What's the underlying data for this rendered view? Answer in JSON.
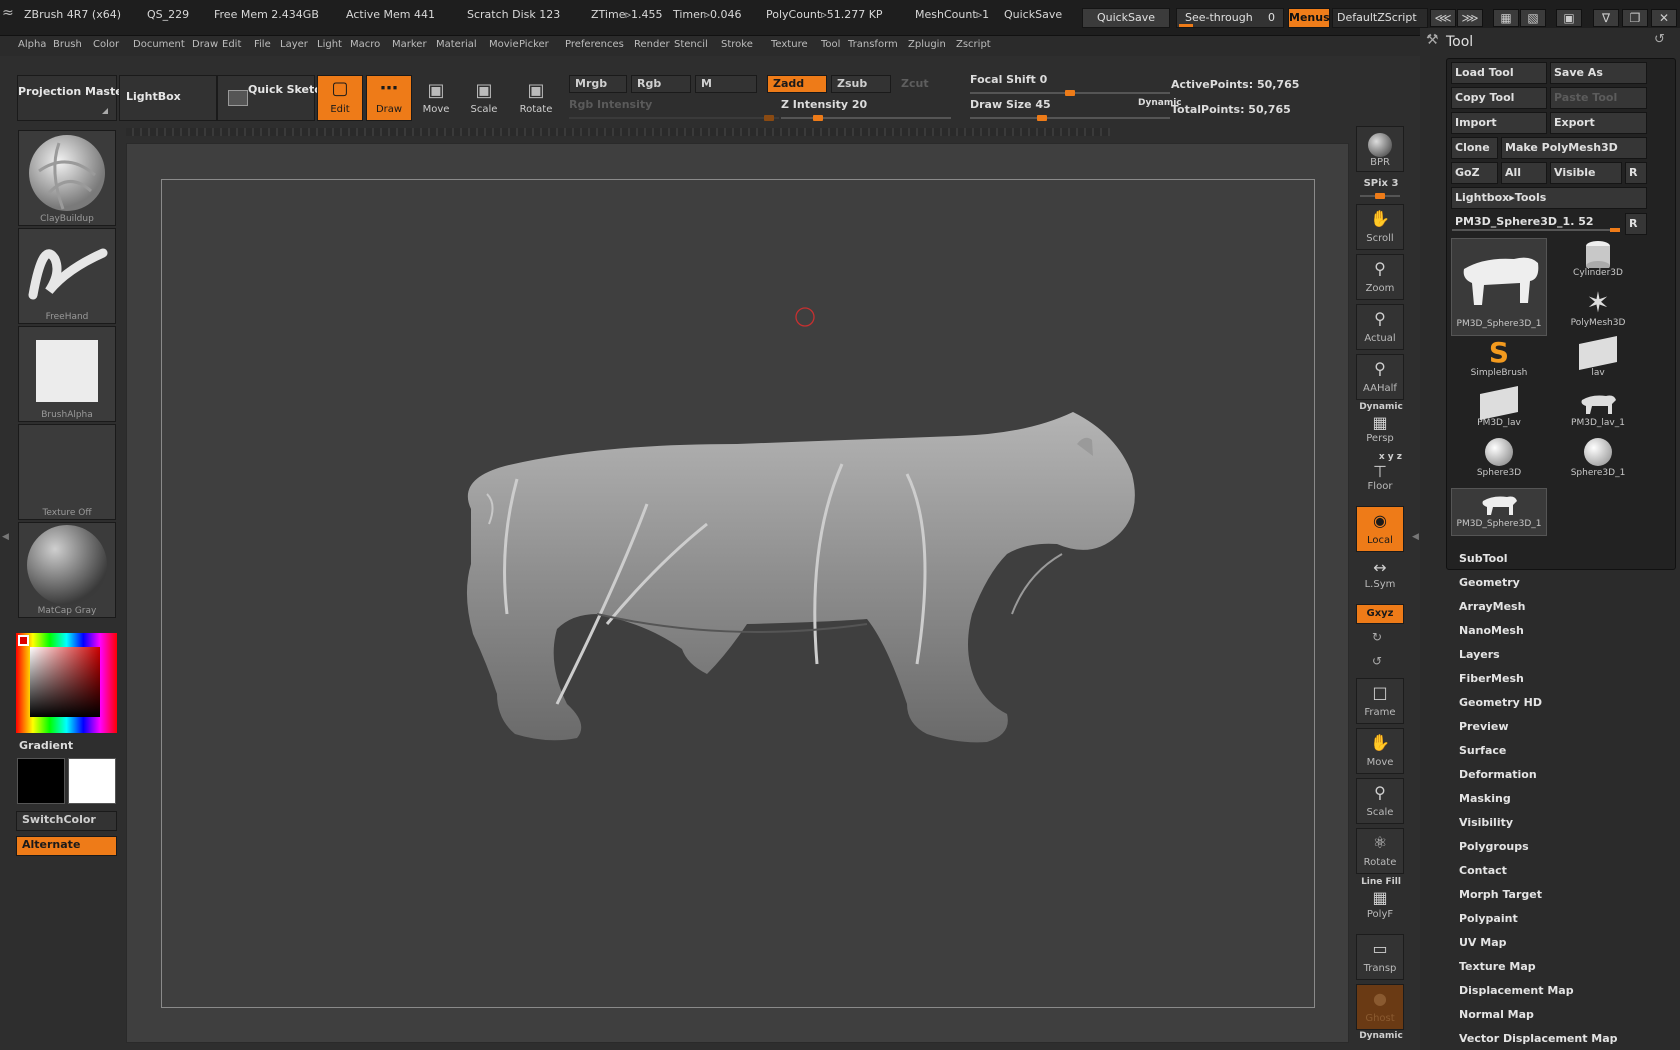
{
  "titlebar": {
    "app": "ZBrush 4R7 (x64)",
    "doc": "QS_229",
    "free_mem": "Free Mem 2.434GB",
    "active_mem": "Active Mem 441",
    "scratch": "Scratch Disk 123",
    "ztime": "ZTime▹1.455",
    "timer": "Timer▹0.046",
    "polycount": "PolyCount▹51.277 KP",
    "meshcount": "MeshCount▹1",
    "quicksave_label": "QuickSave",
    "quicksave_button": "QuickSave",
    "seethrough": "See-through",
    "seethrough_value": "0",
    "menus": "Menus",
    "zscript": "DefaultZScript"
  },
  "menubar": [
    "Alpha",
    "Brush",
    "Color",
    "Document",
    "Draw",
    "Edit",
    "File",
    "Layer",
    "Light",
    "Macro",
    "Marker",
    "Material",
    "Movie",
    "Picker",
    "Preferences",
    "Render",
    "Stencil",
    "Stroke",
    "Texture",
    "Tool",
    "Transform",
    "Zplugin",
    "Zscript"
  ],
  "toolbar": {
    "projection_master": "Projection Master",
    "lightbox": "LightBox",
    "quick_sketch": "Quick Sketch",
    "edit": "Edit",
    "draw": "Draw",
    "move": "Move",
    "scale": "Scale",
    "rotate": "Rotate",
    "mrgb": "Mrgb",
    "rgb": "Rgb",
    "m": "M",
    "zadd": "Zadd",
    "zsub": "Zsub",
    "zcut": "Zcut",
    "rgb_intensity": "Rgb Intensity",
    "z_intensity": "Z Intensity 20",
    "focal_shift": "Focal Shift 0",
    "draw_size": "Draw Size 45",
    "dynamic": "Dynamic",
    "active_points": "ActivePoints: 50,765",
    "total_points": "TotalPoints: 50,765",
    "z_intensity_level": 0.2,
    "focal_shift_level": 0.5,
    "draw_size_level": 0.35
  },
  "leftpanel": {
    "brush": "ClayBuildup",
    "stroke": "FreeHand",
    "alpha": "BrushAlpha",
    "texture": "Texture Off",
    "material": "MatCap Gray",
    "gradient": "Gradient",
    "switchcolor": "SwitchColor",
    "alternate": "Alternate"
  },
  "shelf": {
    "bpr": "BPR",
    "spix": "SPix 3",
    "scroll": "Scroll",
    "zoom": "Zoom",
    "actual": "Actual",
    "aahalf": "AAHalf",
    "dynamic": "Dynamic",
    "persp": "Persp",
    "xyz_small": "x y z",
    "floor": "Floor",
    "local": "Local",
    "lsym": "L.Sym",
    "xyz": "Gxyz",
    "frame": "Frame",
    "move": "Move",
    "scale": "Scale",
    "rotate": "Rotate",
    "line_fill": "Line Fill",
    "polyf": "PolyF",
    "transp": "Transp",
    "ghost": "Ghost",
    "dynamic2": "Dynamic"
  },
  "toolpanel": {
    "title": "Tool",
    "load_tool": "Load Tool",
    "save_as": "Save As",
    "copy_tool": "Copy Tool",
    "paste_tool": "Paste Tool",
    "import": "Import",
    "export": "Export",
    "clone": "Clone",
    "make_polymesh": "Make PolyMesh3D",
    "goz": "GoZ",
    "all": "All",
    "visible": "Visible",
    "r": "R",
    "lightbox_tools": "Lightbox▸Tools",
    "current_tool": "PM3D_Sphere3D_1. 52",
    "tools": [
      "PM3D_Sphere3D_1",
      "Cylinder3D",
      "PolyMesh3D",
      "SimpleBrush",
      "lav",
      "PM3D_lav",
      "PM3D_lav_1",
      "Sphere3D",
      "Sphere3D_1",
      "PM3D_Sphere3D_1"
    ],
    "sections": [
      "SubTool",
      "Geometry",
      "ArrayMesh",
      "NanoMesh",
      "Layers",
      "FiberMesh",
      "Geometry HD",
      "Preview",
      "Surface",
      "Deformation",
      "Masking",
      "Visibility",
      "Polygroups",
      "Contact",
      "Morph Target",
      "Polypaint",
      "UV Map",
      "Texture Map",
      "Displacement Map",
      "Normal Map",
      "Vector Displacement Map"
    ]
  }
}
